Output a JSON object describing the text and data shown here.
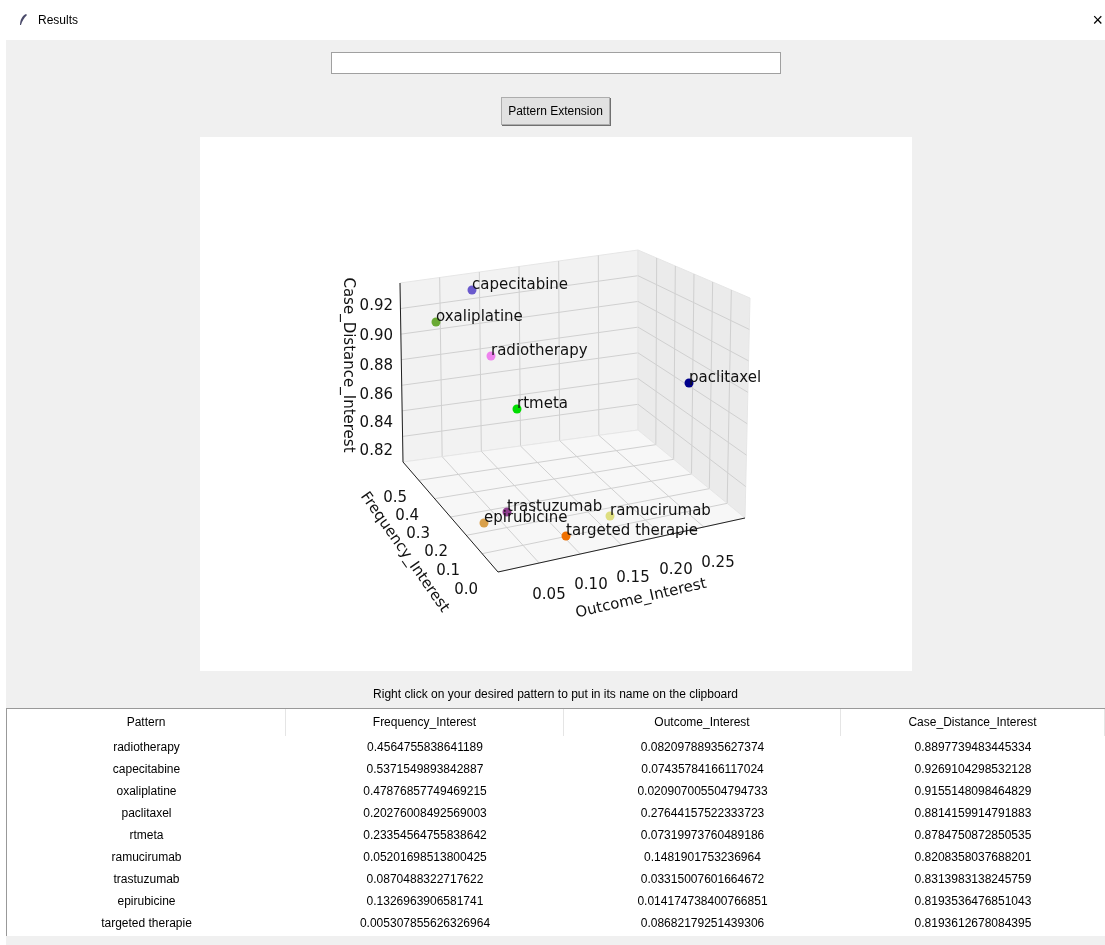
{
  "window": {
    "title": "Results",
    "close": "×"
  },
  "button": "Pattern Extension",
  "plot": {
    "z_axis": {
      "label": "Case_Distance_Interest",
      "ticks": [
        "0.92",
        "0.90",
        "0.88",
        "0.86",
        "0.84",
        "0.82"
      ]
    },
    "y_axis": {
      "label": "Frequency_Interest",
      "ticks": [
        "0.5",
        "0.4",
        "0.3",
        "0.2",
        "0.1",
        "0.0"
      ]
    },
    "x_axis": {
      "label": "Outcome_Interest",
      "ticks": [
        "0.05",
        "0.10",
        "0.15",
        "0.20",
        "0.25"
      ]
    },
    "points": [
      {
        "label": "capecitabine",
        "color": "#6a5acd"
      },
      {
        "label": "oxaliplatine",
        "color": "#6aaa34"
      },
      {
        "label": "radiotherapy",
        "color": "#ee82ee"
      },
      {
        "label": "paclitaxel",
        "color": "#00008b"
      },
      {
        "label": "rtmeta",
        "color": "#00dd00"
      },
      {
        "label": "trastuzumab",
        "color": "#8e3e8e"
      },
      {
        "label": "ramucirumab",
        "color": "#dede80"
      },
      {
        "label": "epirubicine",
        "color": "#d9a04a"
      },
      {
        "label": "targeted therapie",
        "color": "#f07000"
      }
    ]
  },
  "hint": "Right click on your desired pattern to put in its name on the clipboard",
  "table": {
    "columns": [
      "Pattern",
      "Frequency_Interest",
      "Outcome_Interest",
      "Case_Distance_Interest"
    ],
    "rows": [
      [
        "radiotherapy",
        "0.4564755838641189",
        "0.08209788935627374",
        "0.8897739483445334"
      ],
      [
        "capecitabine",
        "0.5371549893842887",
        "0.07435784166117024",
        "0.9269104298532128"
      ],
      [
        "oxaliplatine",
        "0.47876857749469215",
        "0.020907005504794733",
        "0.9155148098464829"
      ],
      [
        "paclitaxel",
        "0.20276008492569003",
        "0.27644157522333723",
        "0.8814159914791883"
      ],
      [
        "rtmeta",
        "0.23354564755838642",
        "0.07319973760489186",
        "0.8784750872850535"
      ],
      [
        "ramucirumab",
        "0.05201698513800425",
        "0.1481901753236964",
        "0.8208358037688201"
      ],
      [
        "trastuzumab",
        "0.0870488322717622",
        "0.03315007601664672",
        "0.8313983138245759"
      ],
      [
        "epirubicine",
        "0.1326963906581741",
        "0.014174738400766851",
        "0.8193536476851043"
      ],
      [
        "targeted therapie",
        "0.005307855626326964",
        "0.08682179251439306",
        "0.8193612678084395"
      ]
    ]
  }
}
